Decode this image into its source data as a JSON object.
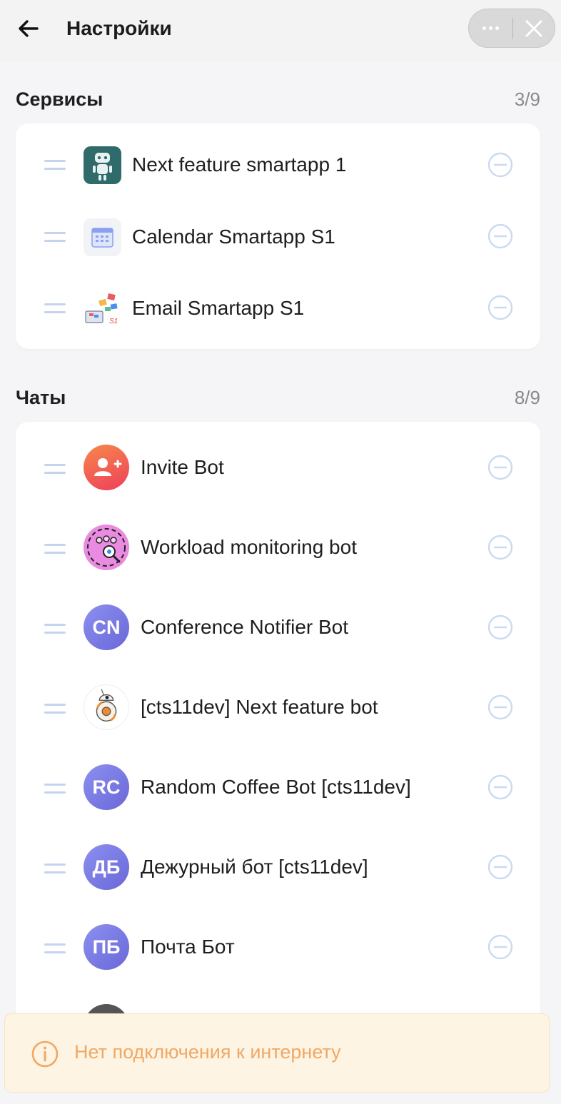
{
  "header": {
    "title": "Настройки"
  },
  "services": {
    "title": "Сервисы",
    "count": "3/9",
    "items": [
      {
        "label": "Next feature smartapp 1",
        "icon": "robot-icon"
      },
      {
        "label": "Calendar Smartapp S1",
        "icon": "calendar-icon"
      },
      {
        "label": "Email Smartapp S1",
        "icon": "email-illustration-icon"
      }
    ]
  },
  "chats": {
    "title": "Чаты",
    "count": "8/9",
    "items": [
      {
        "label": "Invite Bot",
        "avatar": "add-user-icon"
      },
      {
        "label": "Workload monitoring bot",
        "avatar": "team-monitor-icon"
      },
      {
        "label": "Conference Notifier Bot",
        "initials": "CN"
      },
      {
        "label": "[cts11dev] Next feature bot",
        "avatar": "droid-icon"
      },
      {
        "label": "Random Coffee Bot [cts11dev]",
        "initials": "RC"
      },
      {
        "label": "Дежурный бот [cts11dev]",
        "initials": "ДБ"
      },
      {
        "label": "Почта Бот",
        "initials": "ПБ"
      }
    ]
  },
  "banner": {
    "text": "Нет подключения к интернету",
    "icon": "info-icon"
  },
  "colors": {
    "accent_minus": "#c9daf2",
    "banner_text": "#f0a865",
    "initials_avatar": "#7b7ae6"
  }
}
